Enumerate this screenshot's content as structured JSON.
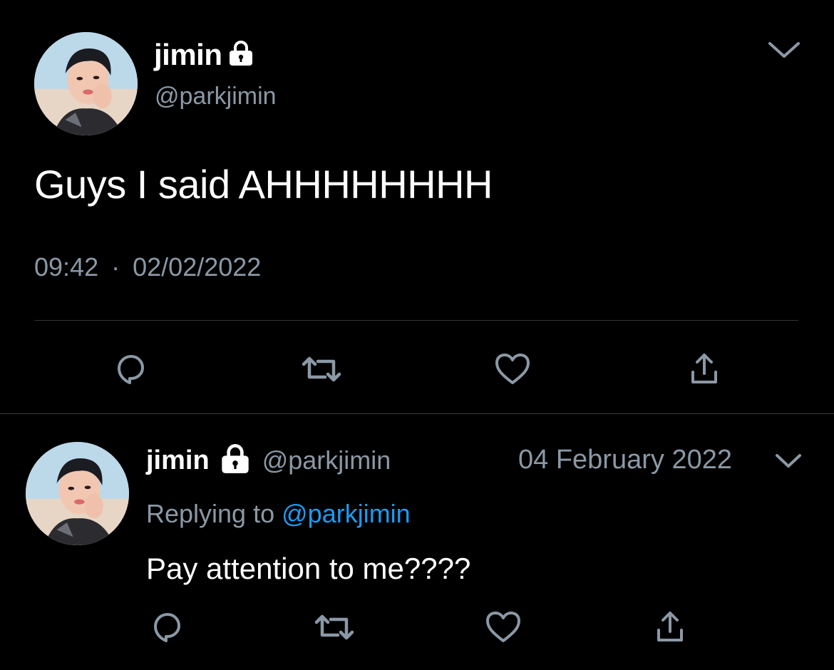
{
  "main_tweet": {
    "display_name": "jimin",
    "handle": "@parkjimin",
    "text": "Guys I said AHHHHHHHH",
    "time": "09:42",
    "separator": "·",
    "date": "02/02/2022",
    "avatar_icon": "profile-photo",
    "protected_icon": "lock-icon"
  },
  "reply_tweet": {
    "display_name": "jimin",
    "handle": "@parkjimin",
    "date": "04 February 2022",
    "replying_prefix": "Replying to",
    "replying_handle": "@parkjimin",
    "text": "Pay attention to me????",
    "avatar_icon": "profile-photo",
    "protected_icon": "lock-icon"
  },
  "actions": [
    "reply-icon",
    "retweet-icon",
    "like-icon",
    "share-icon"
  ],
  "colors": {
    "background": "#000000",
    "text": "#ffffff",
    "secondary": "#8b98a5",
    "link": "#1d9bf0",
    "divider": "#2f3336"
  }
}
